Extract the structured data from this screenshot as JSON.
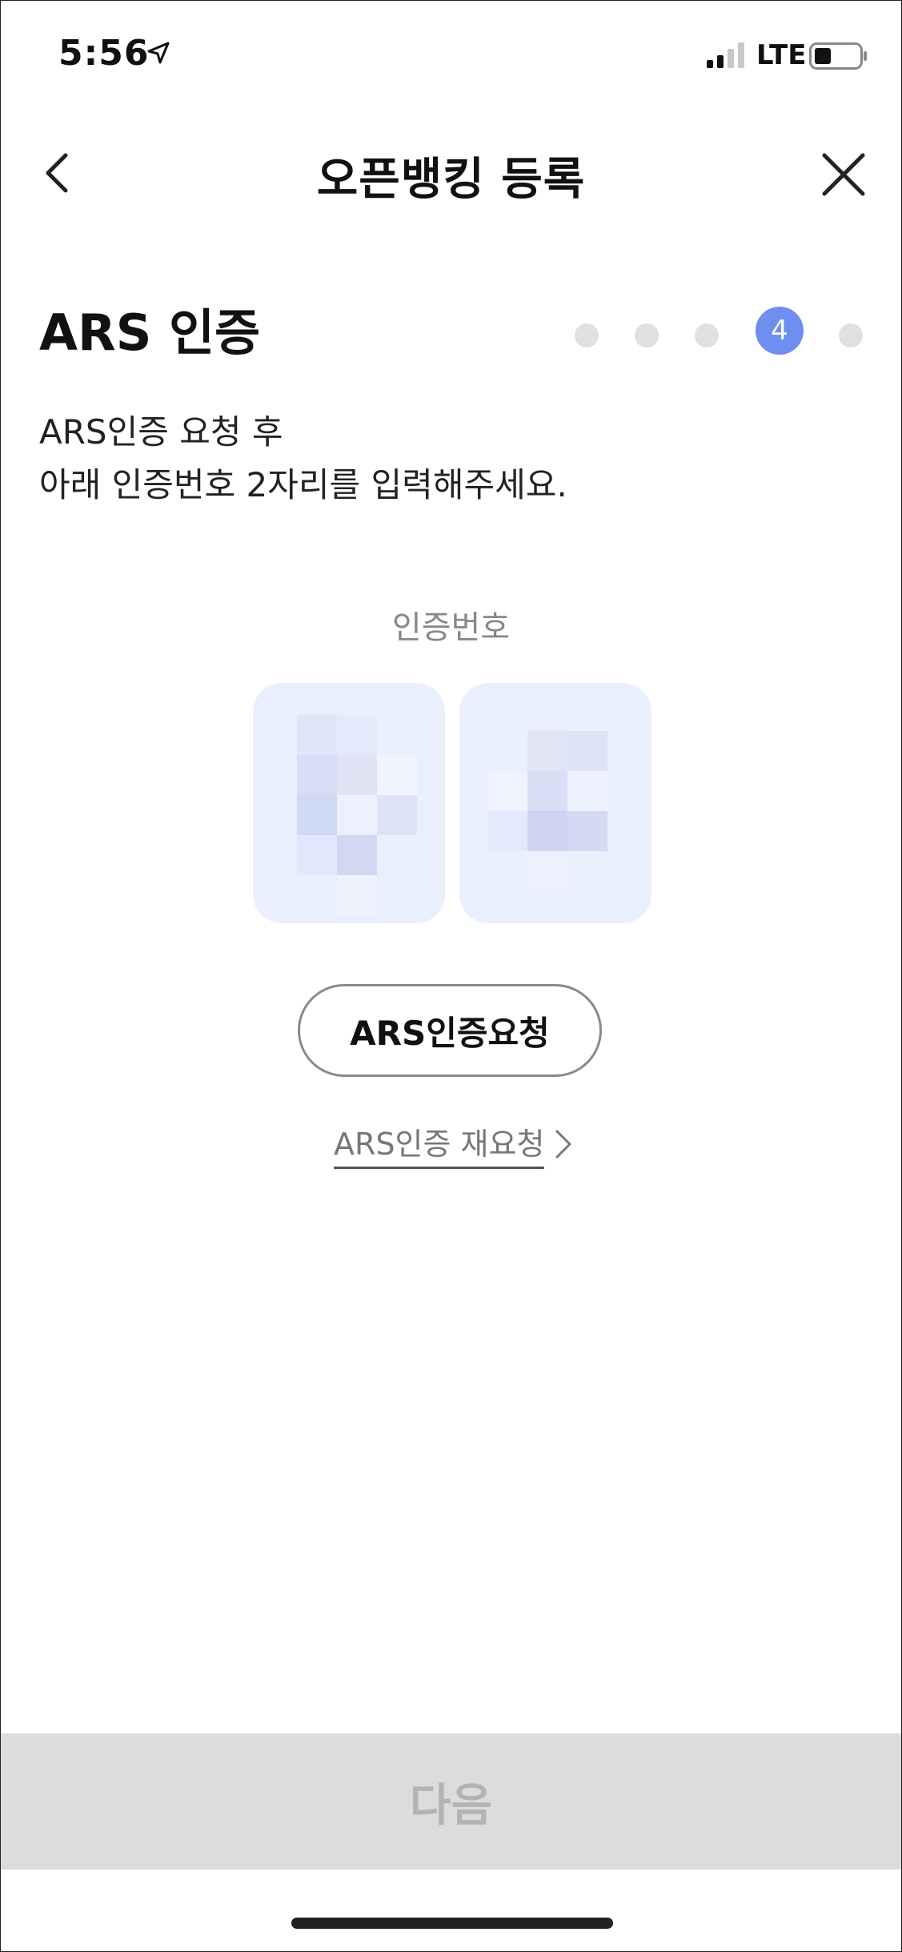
{
  "status_bar": {
    "time": "5:56",
    "network": "LTE",
    "icons": [
      "location-arrow-icon",
      "cellular-signal-icon",
      "battery-icon"
    ]
  },
  "header": {
    "title": "오픈뱅킹 등록",
    "back_icon": "chevron-left-icon",
    "close_icon": "close-icon"
  },
  "section": {
    "title": "ARS 인증"
  },
  "stepper": {
    "current_step_label": "4",
    "current_step": 4,
    "total_steps": 5
  },
  "instructions": {
    "line1": "ARS인증 요청 후",
    "line2": "아래 인증번호 2자리를 입력해주세요."
  },
  "code": {
    "label": "인증번호"
  },
  "actions": {
    "ars_request_label": "ARS인증요청",
    "ars_rerequest_label": "ARS인증 재요청",
    "next_label": "다음"
  },
  "colors": {
    "accent": "#6e8ef0",
    "code_box_bg": "#e9effd",
    "disabled_bar": "#dcdcdc",
    "disabled_text": "#b3b3b3"
  }
}
